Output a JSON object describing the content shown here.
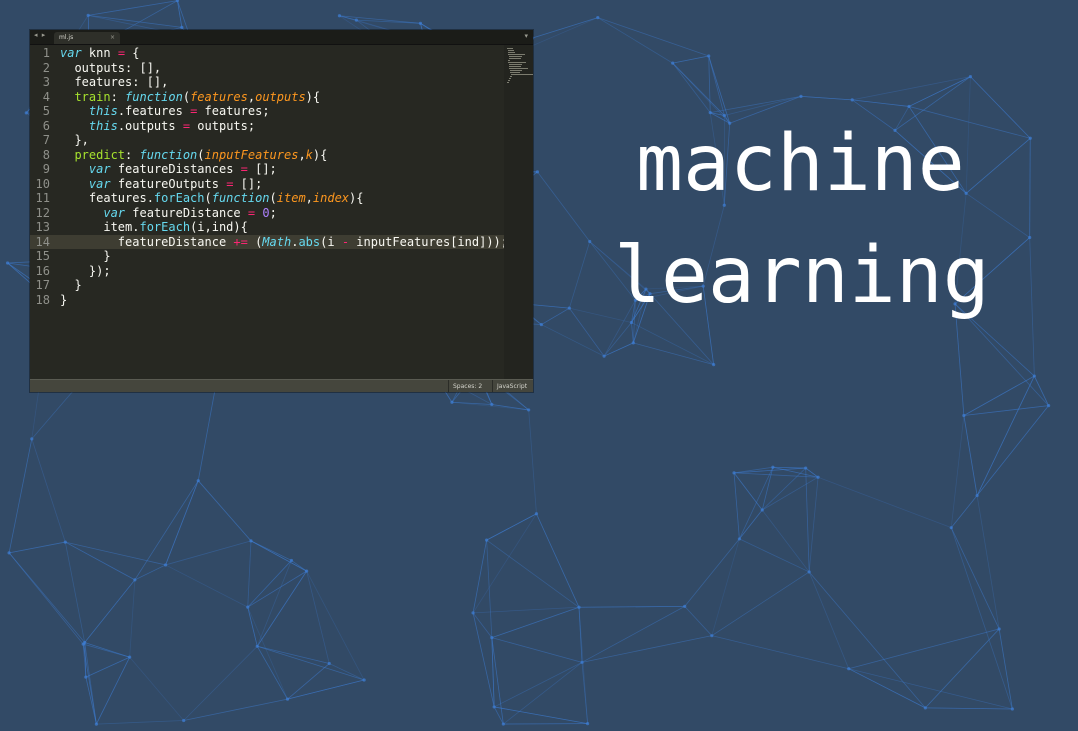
{
  "editor": {
    "nav_arrows": "◂ ▸",
    "tab_label": "ml.js",
    "tab_close": "×",
    "menu_caret": "▾",
    "current_line": 14,
    "code_lines": [
      [
        {
          "t": "var",
          "c": "kw"
        },
        {
          "t": " knn ",
          "c": "plain"
        },
        {
          "t": "=",
          "c": "op"
        },
        {
          "t": " {",
          "c": "plain"
        }
      ],
      [
        {
          "t": "  outputs: [],",
          "c": "plain"
        }
      ],
      [
        {
          "t": "  features: [],",
          "c": "plain"
        }
      ],
      [
        {
          "t": "  ",
          "c": "plain"
        },
        {
          "t": "train",
          "c": "fn"
        },
        {
          "t": ": ",
          "c": "plain"
        },
        {
          "t": "function",
          "c": "kw"
        },
        {
          "t": "(",
          "c": "plain"
        },
        {
          "t": "features",
          "c": "param"
        },
        {
          "t": ",",
          "c": "plain"
        },
        {
          "t": "outputs",
          "c": "param"
        },
        {
          "t": "){",
          "c": "plain"
        }
      ],
      [
        {
          "t": "    ",
          "c": "plain"
        },
        {
          "t": "this",
          "c": "this"
        },
        {
          "t": ".features ",
          "c": "plain"
        },
        {
          "t": "=",
          "c": "op"
        },
        {
          "t": " features;",
          "c": "plain"
        }
      ],
      [
        {
          "t": "    ",
          "c": "plain"
        },
        {
          "t": "this",
          "c": "this"
        },
        {
          "t": ".outputs ",
          "c": "plain"
        },
        {
          "t": "=",
          "c": "op"
        },
        {
          "t": " outputs;",
          "c": "plain"
        }
      ],
      [
        {
          "t": "  },",
          "c": "plain"
        }
      ],
      [
        {
          "t": "  ",
          "c": "plain"
        },
        {
          "t": "predict",
          "c": "fn"
        },
        {
          "t": ": ",
          "c": "plain"
        },
        {
          "t": "function",
          "c": "kw"
        },
        {
          "t": "(",
          "c": "plain"
        },
        {
          "t": "inputFeatures",
          "c": "param"
        },
        {
          "t": ",",
          "c": "plain"
        },
        {
          "t": "k",
          "c": "param"
        },
        {
          "t": "){",
          "c": "plain"
        }
      ],
      [
        {
          "t": "    ",
          "c": "plain"
        },
        {
          "t": "var",
          "c": "kw"
        },
        {
          "t": " featureDistances ",
          "c": "plain"
        },
        {
          "t": "=",
          "c": "op"
        },
        {
          "t": " [];",
          "c": "plain"
        }
      ],
      [
        {
          "t": "    ",
          "c": "plain"
        },
        {
          "t": "var",
          "c": "kw"
        },
        {
          "t": " featureOutputs ",
          "c": "plain"
        },
        {
          "t": "=",
          "c": "op"
        },
        {
          "t": " [];",
          "c": "plain"
        }
      ],
      [
        {
          "t": "    features.",
          "c": "plain"
        },
        {
          "t": "forEach",
          "c": "call"
        },
        {
          "t": "(",
          "c": "plain"
        },
        {
          "t": "function",
          "c": "kw"
        },
        {
          "t": "(",
          "c": "plain"
        },
        {
          "t": "item",
          "c": "param"
        },
        {
          "t": ",",
          "c": "plain"
        },
        {
          "t": "index",
          "c": "param"
        },
        {
          "t": "){",
          "c": "plain"
        }
      ],
      [
        {
          "t": "      ",
          "c": "plain"
        },
        {
          "t": "var",
          "c": "kw"
        },
        {
          "t": " featureDistance ",
          "c": "plain"
        },
        {
          "t": "=",
          "c": "op"
        },
        {
          "t": " ",
          "c": "plain"
        },
        {
          "t": "0",
          "c": "num"
        },
        {
          "t": ";",
          "c": "plain"
        }
      ],
      [
        {
          "t": "      item.",
          "c": "plain"
        },
        {
          "t": "forEach",
          "c": "call"
        },
        {
          "t": "(i,ind){",
          "c": "plain"
        }
      ],
      [
        {
          "t": "        featureDistance ",
          "c": "plain"
        },
        {
          "t": "+=",
          "c": "op"
        },
        {
          "t": " (",
          "c": "plain"
        },
        {
          "t": "Math",
          "c": "this"
        },
        {
          "t": ".",
          "c": "plain"
        },
        {
          "t": "abs",
          "c": "call"
        },
        {
          "t": "(i ",
          "c": "plain"
        },
        {
          "t": "-",
          "c": "op"
        },
        {
          "t": " inputFeatures[ind]));",
          "c": "plain"
        }
      ],
      [
        {
          "t": "      }",
          "c": "plain"
        }
      ],
      [
        {
          "t": "    });",
          "c": "plain"
        }
      ],
      [
        {
          "t": "  }",
          "c": "plain"
        }
      ],
      [
        {
          "t": "}",
          "c": "plain"
        }
      ]
    ],
    "status_spaces": "Spaces: 2",
    "status_syntax": "JavaScript"
  },
  "headline": {
    "line1": "machine",
    "line2": "learning"
  },
  "colors": {
    "background": "#324a66",
    "mesh": "#3f7fd6",
    "kw": "#66d9ef",
    "fn": "#a6e22e",
    "param": "#fd971f",
    "op": "#f92672",
    "num": "#ae81ff",
    "call": "#66d9ef",
    "this": "#66d9ef",
    "plain": "#f8f8f2"
  }
}
